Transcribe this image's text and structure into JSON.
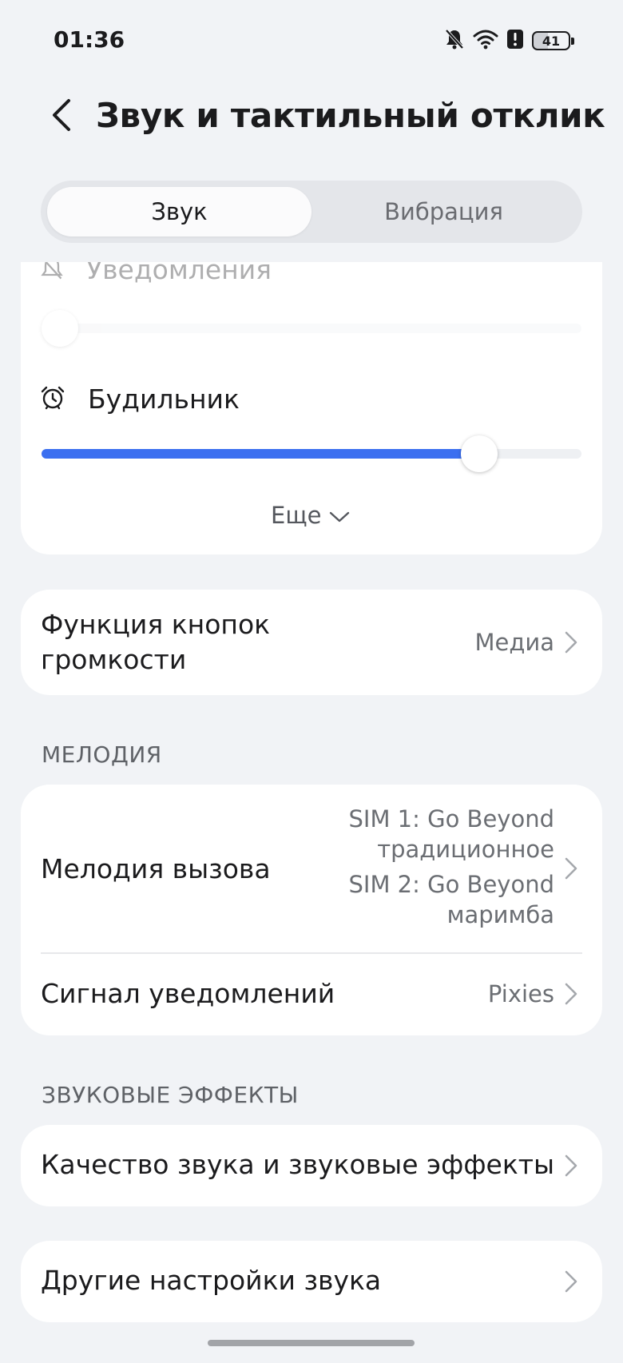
{
  "status_bar": {
    "time": "01:36",
    "battery": "41",
    "icons": [
      "bell-off-icon",
      "wifi-icon",
      "alert-icon",
      "battery-icon"
    ]
  },
  "header": {
    "back_icon": "chevron-left-icon",
    "title": "Звук и тактильный отклик"
  },
  "tabs": [
    {
      "label": "Звук",
      "active": true
    },
    {
      "label": "Вибрация",
      "active": false
    }
  ],
  "volume": {
    "notifications": {
      "label": "Уведомления",
      "icon": "bell-off-icon",
      "level": 0.0
    },
    "alarm": {
      "label": "Будильник",
      "icon": "alarm-clock-icon",
      "level": 0.81
    },
    "more_label": "Еще"
  },
  "volume_buttons": {
    "title": "Функция кнопок громкости",
    "value": "Медиа"
  },
  "melody_section": {
    "header": "МЕЛОДИЯ",
    "ringtone": {
      "title": "Мелодия вызова",
      "sim1_line1": "SIM 1: Go Beyond",
      "sim1_line2": "традиционное",
      "sim2_line1": "SIM 2: Go Beyond",
      "sim2_line2": "маримба"
    },
    "notification_sound": {
      "title": "Сигнал уведомлений",
      "value": "Pixies"
    }
  },
  "effects_section": {
    "header": "ЗВУКОВЫЕ ЭФФЕКТЫ",
    "quality": {
      "title": "Качество звука и звуковые эффекты"
    }
  },
  "other": {
    "title": "Другие настройки звука"
  },
  "colors": {
    "background": "#f1f3f6",
    "accent": "#3b6ff0",
    "card": "#ffffff"
  }
}
